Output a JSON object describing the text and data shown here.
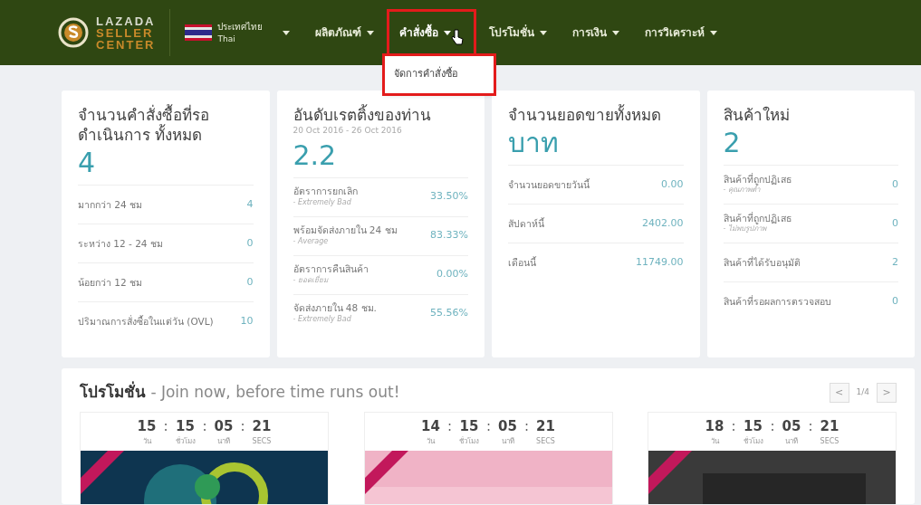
{
  "navbar": {
    "logo": {
      "line_1": "LAZADA",
      "line_2": "SELLER",
      "line_3": "CENTER"
    },
    "country": {
      "label": "ประเทศไทย",
      "sublabel": "Thai"
    },
    "menu": [
      {
        "label": "ผลิตภัณฑ์",
        "selected": false,
        "highlighted": false
      },
      {
        "label": "คำสั่งซื้อ",
        "selected": true,
        "highlighted": true
      },
      {
        "label": "โปรโมชั่น",
        "selected": false,
        "highlighted": false
      },
      {
        "label": "การเงิน",
        "selected": false,
        "highlighted": false
      },
      {
        "label": "การวิเคราะห์",
        "selected": false,
        "highlighted": false
      }
    ],
    "dropdown": {
      "items": [
        {
          "label": "จัดการคำสั่งซื้อ"
        }
      ],
      "highlighted": true
    }
  },
  "stats": [
    {
      "title": "จำนวนคำสั่งซื้อที่รอดำเนินการ ทั้งหมด",
      "value": "4",
      "rows": [
        {
          "label": "มากกว่า 24 ชม",
          "value": "4"
        },
        {
          "label": "ระหว่าง 12 - 24 ชม",
          "value": "0"
        },
        {
          "label": "น้อยกว่า 12 ชม",
          "value": "0"
        },
        {
          "label": "ปริมาณการสั่งซื้อในแต่วัน (OVL)",
          "value": "10"
        }
      ]
    },
    {
      "title": "อันดับเรตติ้งของท่าน",
      "subtitle": "20 Oct 2016 - 26 Oct 2016",
      "value": "2.2",
      "rows": [
        {
          "label": "อัตราการยกเลิก",
          "note": "- Extremely Bad",
          "value": "33.50%"
        },
        {
          "label": "พร้อมจัดส่งภายใน 24 ชม",
          "note": "- Average",
          "value": "83.33%"
        },
        {
          "label": "อัตราการคืนสินค้า",
          "note": "- ยอดเยี่ยม",
          "value": "0.00%"
        },
        {
          "label": "จัดส่งภายใน 48 ชม.",
          "note": "- Extremely Bad",
          "value": "55.56%"
        }
      ]
    },
    {
      "title": "จำนวนยอดขายทั้งหมด",
      "value": "บาท",
      "rows": [
        {
          "label": "จำนวนยอดขายวันนี้",
          "value": "0.00"
        },
        {
          "label": "สัปดาห์นี้",
          "value": "2402.00"
        },
        {
          "label": "เดือนนี้",
          "value": "11749.00"
        }
      ]
    },
    {
      "title": "สินค้าใหม่",
      "value": "2",
      "rows": [
        {
          "label": "สินค้าที่ถูกปฏิเสธ",
          "note": "- คุณภาพต่ำ",
          "value": "0"
        },
        {
          "label": "สินค้าที่ถูกปฏิเสธ",
          "note": "- ไม่พบรูปภาพ",
          "value": "0"
        },
        {
          "label": "สินค้าที่ได้รับอนุมัติ",
          "value": "2"
        },
        {
          "label": "สินค้าที่รอผลการตรวจสอบ",
          "value": "0"
        }
      ]
    }
  ],
  "promotions": {
    "title": "**โปรโมชั่น** - Join now, before time runs out!",
    "pager": {
      "prev": "<",
      "page": "1/4",
      "next": ">"
    },
    "items": [
      {
        "countdown": [
          {
            "value": "15",
            "unit": "วัน"
          },
          {
            "value": "15",
            "unit": "ชั่วโมง"
          },
          {
            "value": "05",
            "unit": "นาที"
          },
          {
            "value": "21",
            "unit": "SECS"
          }
        ],
        "separator": ":",
        "picture": {
          "kind": "picture"
        }
      },
      {
        "countdown": [
          {
            "value": "14",
            "unit": "วัน"
          },
          {
            "value": "15",
            "unit": "ชั่วโมง"
          },
          {
            "value": "05",
            "unit": "นาที"
          },
          {
            "value": "21",
            "unit": "SECS"
          }
        ],
        "separator": ":",
        "picture": {
          "kind": "picture"
        }
      },
      {
        "countdown": [
          {
            "value": "18",
            "unit": "วัน"
          },
          {
            "value": "15",
            "unit": "ชั่วโมง"
          },
          {
            "value": "05",
            "unit": "นาที"
          },
          {
            "value": "21",
            "unit": "SECS"
          }
        ],
        "separator": ":",
        "picture": {
          "kind": "picture"
        }
      }
    ]
  }
}
